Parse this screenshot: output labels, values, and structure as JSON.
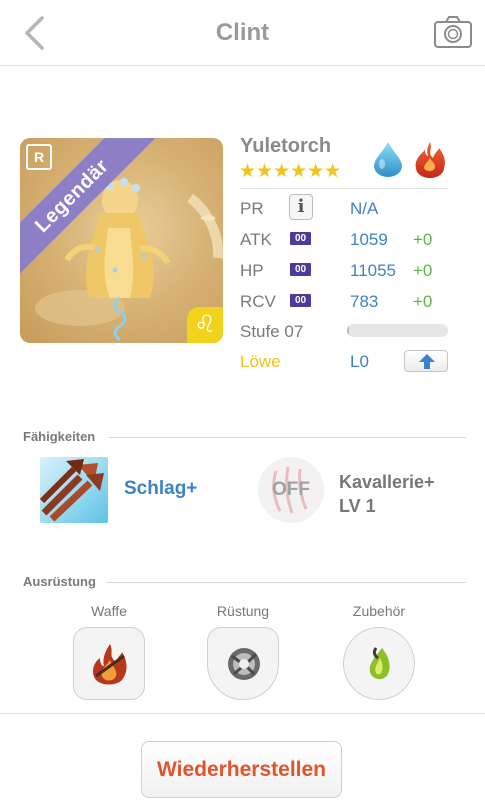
{
  "header": {
    "title": "Clint",
    "back_icon": "chevron-left-icon",
    "camera_icon": "camera-icon"
  },
  "hero": {
    "rarity_ribbon": "Legendär",
    "rarity_tag": "R",
    "zodiac_badge": "♌",
    "name": "Yuletorch",
    "stars": "★★★★★★",
    "star_count": 6,
    "elements": [
      "water-drop-icon",
      "fire-icon"
    ],
    "colors": {
      "ribbon": "#8d7fc6",
      "zodiac": "#f2d21b",
      "star": "#f3c21b"
    }
  },
  "stats": {
    "pr": {
      "label": "PR",
      "value": "N/A"
    },
    "atk": {
      "label": "ATK",
      "badge": "00",
      "value": "1059",
      "bonus": "+0"
    },
    "hp": {
      "label": "HP",
      "badge": "00",
      "value": "11055",
      "bonus": "+0"
    },
    "rcv": {
      "label": "RCV",
      "badge": "00",
      "value": "783",
      "bonus": "+0"
    },
    "level": {
      "label": "Stufe 07",
      "progress": 0.02
    },
    "zodiac": {
      "label": "Löwe",
      "value": "L0"
    }
  },
  "skills": {
    "section_title": "Fähigkeiten",
    "active": {
      "name": "Schlag+"
    },
    "passive": {
      "state": "OFF",
      "name_line1": "Kavallerie+",
      "name_line2": "LV 1"
    }
  },
  "equipment": {
    "section_title": "Ausrüstung",
    "slots": [
      {
        "label": "Waffe"
      },
      {
        "label": "Rüstung"
      },
      {
        "label": "Zubehör"
      }
    ]
  },
  "footer": {
    "restore_label": "Wiederherstellen"
  }
}
